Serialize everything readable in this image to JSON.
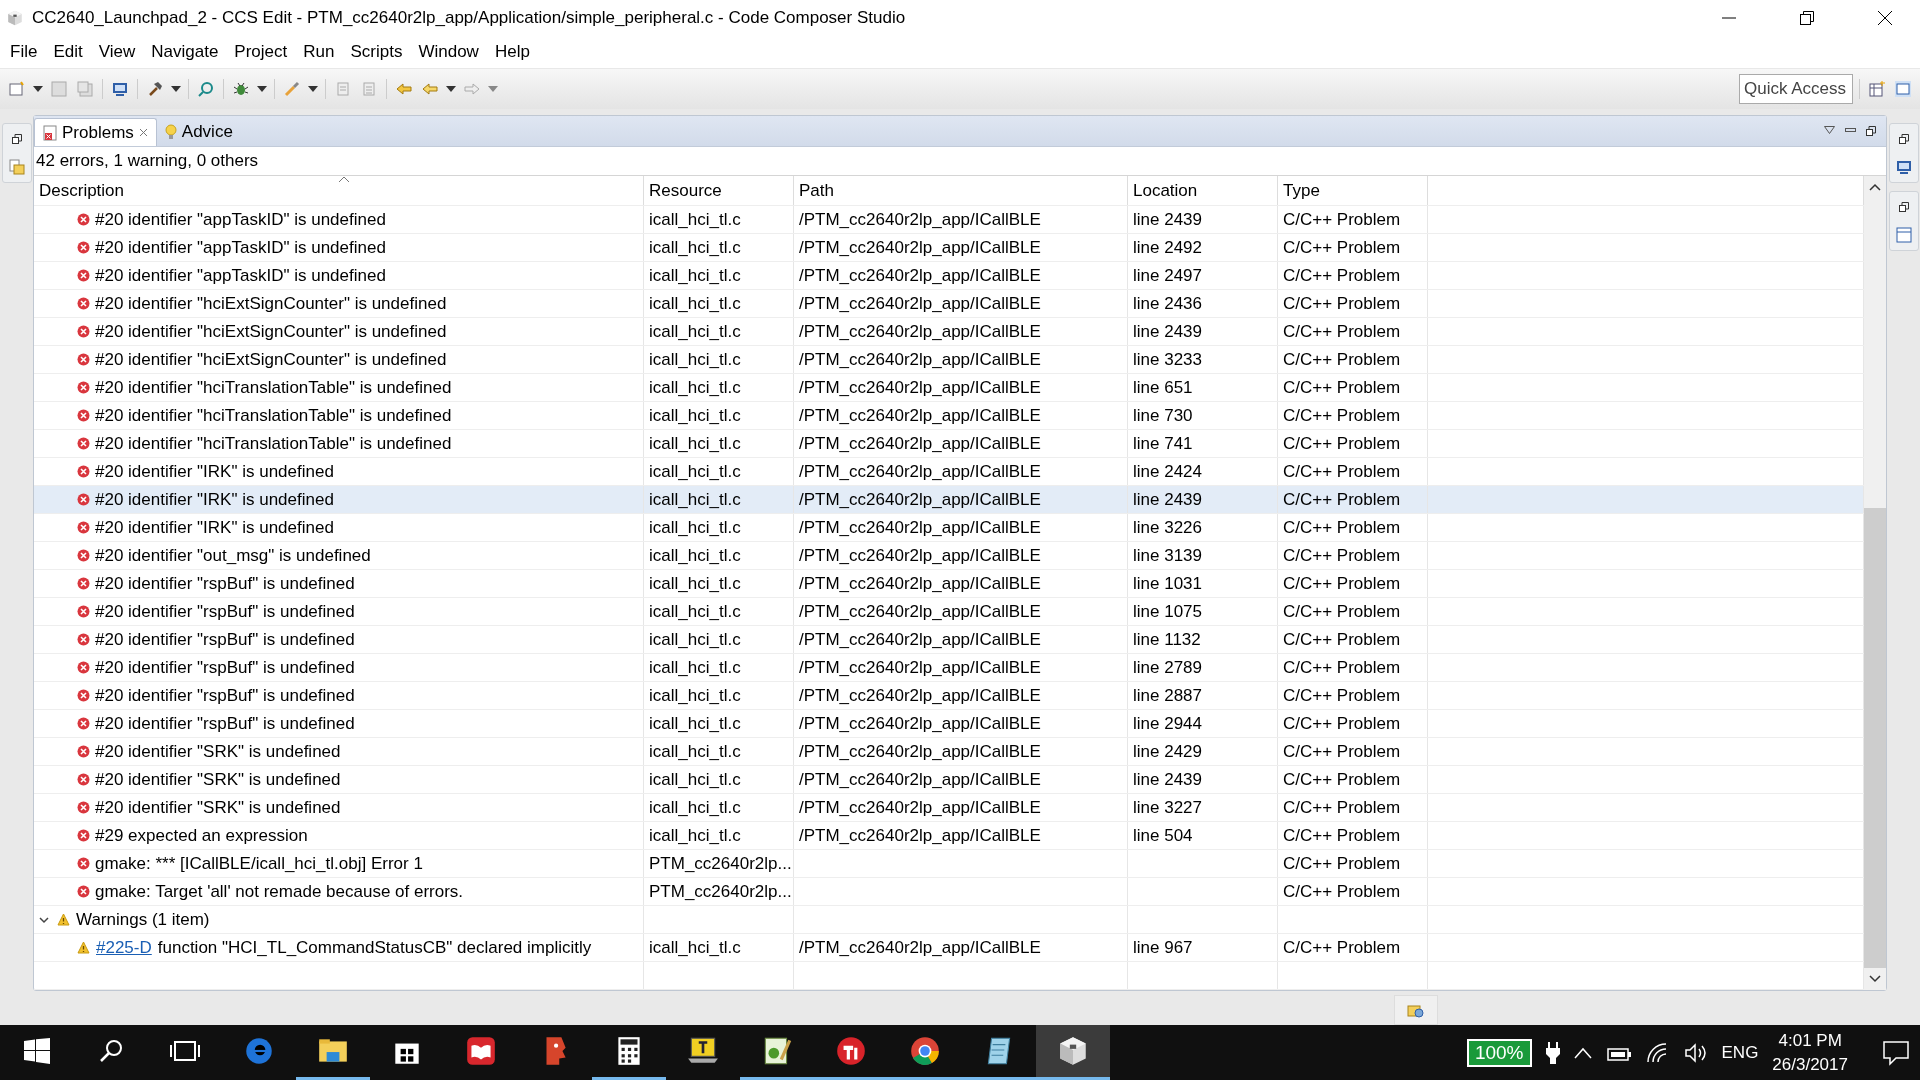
{
  "window": {
    "title": "CC2640_Launchpad_2 - CCS Edit - PTM_cc2640r2lp_app/Application/simple_peripheral.c - Code Composer Studio"
  },
  "menu": [
    "File",
    "Edit",
    "View",
    "Navigate",
    "Project",
    "Run",
    "Scripts",
    "Window",
    "Help"
  ],
  "quick_access": {
    "placeholder": "Quick Access"
  },
  "tabs": [
    {
      "label": "Problems",
      "selected": true,
      "kind": "problems"
    },
    {
      "label": "Advice",
      "selected": false,
      "kind": "advice"
    }
  ],
  "summary": "42 errors, 1 warning, 0 others",
  "columns": [
    "Description",
    "Resource",
    "Path",
    "Location",
    "Type"
  ],
  "errors": [
    {
      "description": "#20 identifier \"appTaskID\" is undefined",
      "resource": "icall_hci_tl.c",
      "path": "/PTM_cc2640r2lp_app/ICallBLE",
      "location": "line 2439",
      "type": "C/C++ Problem",
      "selected": false
    },
    {
      "description": "#20 identifier \"appTaskID\" is undefined",
      "resource": "icall_hci_tl.c",
      "path": "/PTM_cc2640r2lp_app/ICallBLE",
      "location": "line 2492",
      "type": "C/C++ Problem",
      "selected": false
    },
    {
      "description": "#20 identifier \"appTaskID\" is undefined",
      "resource": "icall_hci_tl.c",
      "path": "/PTM_cc2640r2lp_app/ICallBLE",
      "location": "line 2497",
      "type": "C/C++ Problem",
      "selected": false
    },
    {
      "description": "#20 identifier \"hciExtSignCounter\" is undefined",
      "resource": "icall_hci_tl.c",
      "path": "/PTM_cc2640r2lp_app/ICallBLE",
      "location": "line 2436",
      "type": "C/C++ Problem",
      "selected": false
    },
    {
      "description": "#20 identifier \"hciExtSignCounter\" is undefined",
      "resource": "icall_hci_tl.c",
      "path": "/PTM_cc2640r2lp_app/ICallBLE",
      "location": "line 2439",
      "type": "C/C++ Problem",
      "selected": false
    },
    {
      "description": "#20 identifier \"hciExtSignCounter\" is undefined",
      "resource": "icall_hci_tl.c",
      "path": "/PTM_cc2640r2lp_app/ICallBLE",
      "location": "line 3233",
      "type": "C/C++ Problem",
      "selected": false
    },
    {
      "description": "#20 identifier \"hciTranslationTable\" is undefined",
      "resource": "icall_hci_tl.c",
      "path": "/PTM_cc2640r2lp_app/ICallBLE",
      "location": "line 651",
      "type": "C/C++ Problem",
      "selected": false
    },
    {
      "description": "#20 identifier \"hciTranslationTable\" is undefined",
      "resource": "icall_hci_tl.c",
      "path": "/PTM_cc2640r2lp_app/ICallBLE",
      "location": "line 730",
      "type": "C/C++ Problem",
      "selected": false
    },
    {
      "description": "#20 identifier \"hciTranslationTable\" is undefined",
      "resource": "icall_hci_tl.c",
      "path": "/PTM_cc2640r2lp_app/ICallBLE",
      "location": "line 741",
      "type": "C/C++ Problem",
      "selected": false
    },
    {
      "description": "#20 identifier \"IRK\" is undefined",
      "resource": "icall_hci_tl.c",
      "path": "/PTM_cc2640r2lp_app/ICallBLE",
      "location": "line 2424",
      "type": "C/C++ Problem",
      "selected": false
    },
    {
      "description": "#20 identifier \"IRK\" is undefined",
      "resource": "icall_hci_tl.c",
      "path": "/PTM_cc2640r2lp_app/ICallBLE",
      "location": "line 2439",
      "type": "C/C++ Problem",
      "selected": true
    },
    {
      "description": "#20 identifier \"IRK\" is undefined",
      "resource": "icall_hci_tl.c",
      "path": "/PTM_cc2640r2lp_app/ICallBLE",
      "location": "line 3226",
      "type": "C/C++ Problem",
      "selected": false
    },
    {
      "description": "#20 identifier \"out_msg\" is undefined",
      "resource": "icall_hci_tl.c",
      "path": "/PTM_cc2640r2lp_app/ICallBLE",
      "location": "line 3139",
      "type": "C/C++ Problem",
      "selected": false
    },
    {
      "description": "#20 identifier \"rspBuf\" is undefined",
      "resource": "icall_hci_tl.c",
      "path": "/PTM_cc2640r2lp_app/ICallBLE",
      "location": "line 1031",
      "type": "C/C++ Problem",
      "selected": false
    },
    {
      "description": "#20 identifier \"rspBuf\" is undefined",
      "resource": "icall_hci_tl.c",
      "path": "/PTM_cc2640r2lp_app/ICallBLE",
      "location": "line 1075",
      "type": "C/C++ Problem",
      "selected": false
    },
    {
      "description": "#20 identifier \"rspBuf\" is undefined",
      "resource": "icall_hci_tl.c",
      "path": "/PTM_cc2640r2lp_app/ICallBLE",
      "location": "line 1132",
      "type": "C/C++ Problem",
      "selected": false
    },
    {
      "description": "#20 identifier \"rspBuf\" is undefined",
      "resource": "icall_hci_tl.c",
      "path": "/PTM_cc2640r2lp_app/ICallBLE",
      "location": "line 2789",
      "type": "C/C++ Problem",
      "selected": false
    },
    {
      "description": "#20 identifier \"rspBuf\" is undefined",
      "resource": "icall_hci_tl.c",
      "path": "/PTM_cc2640r2lp_app/ICallBLE",
      "location": "line 2887",
      "type": "C/C++ Problem",
      "selected": false
    },
    {
      "description": "#20 identifier \"rspBuf\" is undefined",
      "resource": "icall_hci_tl.c",
      "path": "/PTM_cc2640r2lp_app/ICallBLE",
      "location": "line 2944",
      "type": "C/C++ Problem",
      "selected": false
    },
    {
      "description": "#20 identifier \"SRK\" is undefined",
      "resource": "icall_hci_tl.c",
      "path": "/PTM_cc2640r2lp_app/ICallBLE",
      "location": "line 2429",
      "type": "C/C++ Problem",
      "selected": false
    },
    {
      "description": "#20 identifier \"SRK\" is undefined",
      "resource": "icall_hci_tl.c",
      "path": "/PTM_cc2640r2lp_app/ICallBLE",
      "location": "line 2439",
      "type": "C/C++ Problem",
      "selected": false
    },
    {
      "description": "#20 identifier \"SRK\" is undefined",
      "resource": "icall_hci_tl.c",
      "path": "/PTM_cc2640r2lp_app/ICallBLE",
      "location": "line 3227",
      "type": "C/C++ Problem",
      "selected": false
    },
    {
      "description": "#29 expected an expression",
      "resource": "icall_hci_tl.c",
      "path": "/PTM_cc2640r2lp_app/ICallBLE",
      "location": "line 504",
      "type": "C/C++ Problem",
      "selected": false
    },
    {
      "description": "gmake: *** [ICallBLE/icall_hci_tl.obj] Error 1",
      "resource": "PTM_cc2640r2lp...",
      "type": "C/C++ Problem",
      "selected": false
    },
    {
      "description": "gmake: Target 'all' not remade because of errors.",
      "resource": "PTM_cc2640r2lp...",
      "type": "C/C++ Problem",
      "selected": false
    }
  ],
  "warning_group": {
    "label": "Warnings (1 item)",
    "expanded": true,
    "children": [
      {
        "code": "#225-D",
        "description": "function \"HCI_TL_CommandStatusCB\" declared implicitly",
        "resource": "icall_hci_tl.c",
        "path": "/PTM_cc2640r2lp_app/ICallBLE",
        "location": "line 967",
        "type": "C/C++ Problem",
        "selected": false
      }
    ]
  },
  "taskbar": {
    "apps": [
      {
        "kind": "edge",
        "running": false,
        "active": false
      },
      {
        "kind": "explorer",
        "running": true,
        "active": false
      },
      {
        "kind": "store",
        "running": false,
        "active": false
      },
      {
        "kind": "reader",
        "running": false,
        "active": false
      },
      {
        "kind": "head",
        "running": false,
        "active": false
      },
      {
        "kind": "calculator",
        "running": true,
        "active": false
      },
      {
        "kind": "terminal",
        "running": false,
        "active": false
      },
      {
        "kind": "editor",
        "running": true,
        "active": false
      },
      {
        "kind": "ti",
        "running": true,
        "active": false
      },
      {
        "kind": "chrome",
        "running": true,
        "active": false
      },
      {
        "kind": "notepad",
        "running": true,
        "active": false
      },
      {
        "kind": "ccs",
        "running": true,
        "active": true
      }
    ],
    "battery": "100%",
    "language": "ENG",
    "time": "4:01 PM",
    "date": "26/3/2017"
  }
}
